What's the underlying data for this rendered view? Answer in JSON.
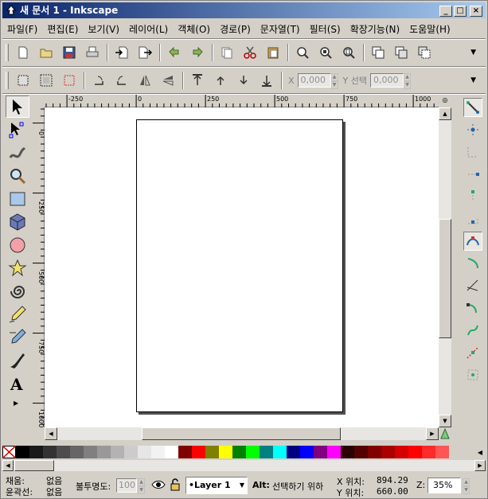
{
  "window": {
    "title": "새 문서 1 - Inkscape",
    "minimize": "_",
    "maximize": "□",
    "close": "×"
  },
  "menu": [
    "파일(F)",
    "편집(E)",
    "보기(V)",
    "레이어(L)",
    "객체(O)",
    "경로(P)",
    "문자열(T)",
    "필터(S)",
    "확장기능(N)",
    "도움말(H)"
  ],
  "toolbar_commands": [
    "new-document",
    "open",
    "save",
    "print",
    "import",
    "export",
    "undo",
    "redo",
    "copy",
    "cut",
    "paste",
    "zoom-selection",
    "zoom-drawing",
    "zoom-page",
    "duplicate",
    "clone",
    "unlink-clone"
  ],
  "toolbar_selector": {
    "icons": [
      "select-all",
      "select-all-layers",
      "deselect",
      "rotate-ccw",
      "rotate-cw",
      "flip-horizontal",
      "flip-vertical",
      "raise-to-top",
      "raise",
      "lower",
      "lower-to-bottom"
    ],
    "x_label": "X",
    "x_value": "0,000",
    "y_label": "Y 선택",
    "y_value": "0,000"
  },
  "left_tools": [
    "selector-tool",
    "node-tool",
    "tweak-tool",
    "zoom-tool",
    "rectangle-tool",
    "3d-box-tool",
    "ellipse-tool",
    "star-tool",
    "spiral-tool",
    "pencil-tool",
    "pen-tool",
    "calligraphy-tool",
    "text-tool"
  ],
  "ruler": {
    "top_labels": [
      "-250",
      "0",
      "250",
      "500",
      "750",
      "1000"
    ],
    "left_labels": [
      "0",
      "250",
      "500",
      "750",
      "1000"
    ]
  },
  "right_tools": [
    "snap-toggle",
    "snap-bbox",
    "snap-bbox-edge",
    "snap-bbox-corner",
    "snap-bbox-midpoint",
    "snap-center",
    "snap-nodes",
    "snap-path",
    "snap-intersection",
    "snap-cusp",
    "snap-smooth",
    "snap-midpoint",
    "snap-object-center"
  ],
  "palette": [
    "#ffffff",
    "#000000",
    "#1a1a1a",
    "#333333",
    "#4d4d4d",
    "#666666",
    "#808080",
    "#999999",
    "#b3b3b3",
    "#cccccc",
    "#e6e6e6",
    "#f2f2f2",
    "#ffffff",
    "#800000",
    "#ff0000",
    "#808000",
    "#ffff00",
    "#008000",
    "#00ff00",
    "#008080",
    "#00ffff",
    "#000080",
    "#0000ff",
    "#800080",
    "#ff00ff",
    "#2b0000",
    "#550000",
    "#800000",
    "#aa0000",
    "#d40000",
    "#ff0000",
    "#ff2a2a",
    "#ff5555"
  ],
  "status": {
    "fill_label": "채움:",
    "fill_value": "없음",
    "stroke_label": "윤곽선:",
    "stroke_value": "없음",
    "opacity_label": "불투명도:",
    "opacity_value": "100",
    "layer": "•Layer 1",
    "message_bold": "Alt:",
    "message": "선택하기 위하",
    "x_label": "X 위치:",
    "x_value": "894.29",
    "y_label": "Y 위치:",
    "y_value": "660.00",
    "zoom_label": "Z:",
    "zoom_value": "35%"
  }
}
